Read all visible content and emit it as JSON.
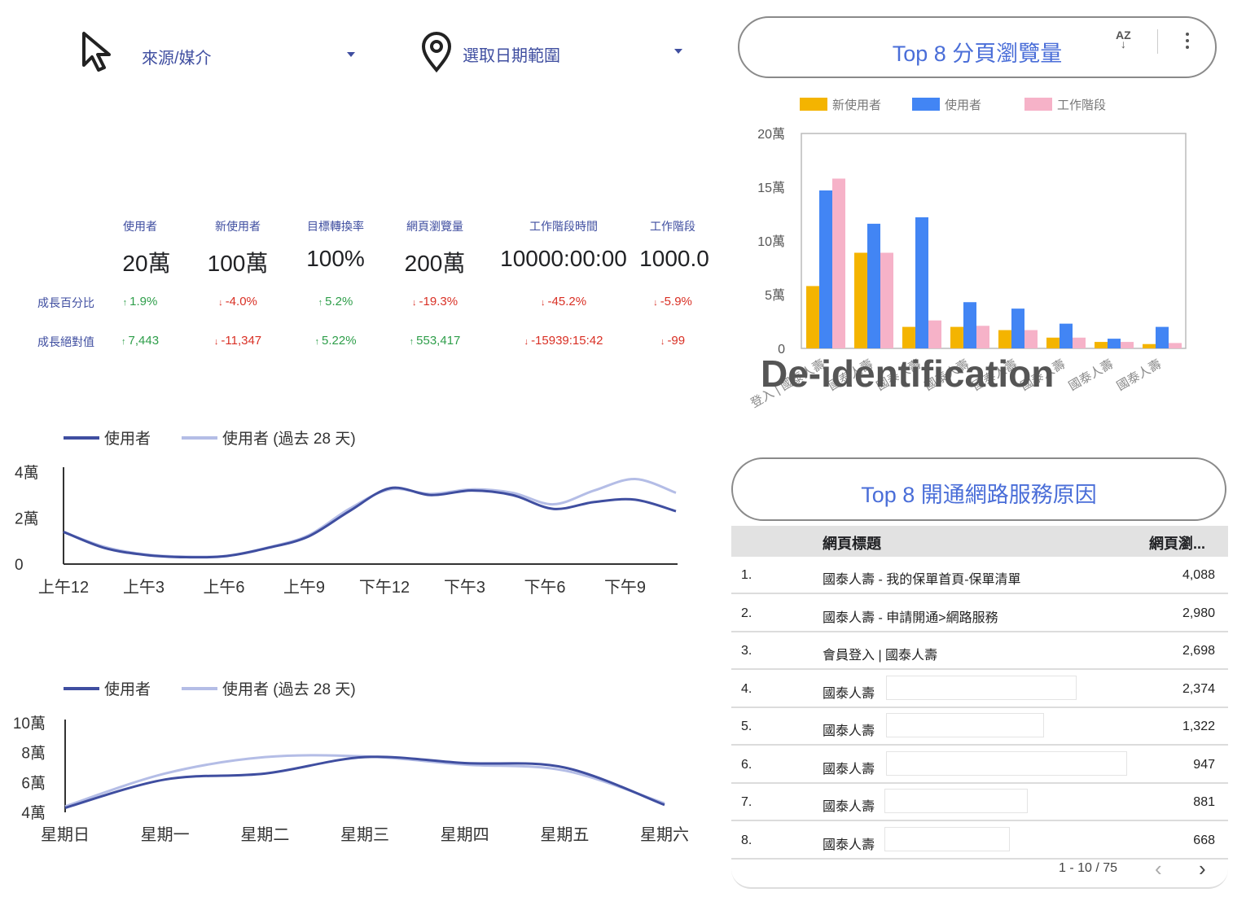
{
  "filters": {
    "source_label": "來源/媒介",
    "date_label": "選取日期範圍"
  },
  "kpis": {
    "row_pct_label": "成長百分比",
    "row_abs_label": "成長絕對值",
    "metrics": [
      {
        "name": "使用者",
        "value": "20萬",
        "pct": "1.9%",
        "pct_dir": "up",
        "abs": "7,443",
        "abs_dir": "up"
      },
      {
        "name": "新使用者",
        "value": "100萬",
        "pct": "-4.0%",
        "pct_dir": "down",
        "abs": "-11,347",
        "abs_dir": "down"
      },
      {
        "name": "目標轉換率",
        "value": "100%",
        "pct": "5.2%",
        "pct_dir": "up",
        "abs": "5.22%",
        "abs_dir": "up"
      },
      {
        "name": "網頁瀏覽量",
        "value": "200萬",
        "pct": "-19.3%",
        "pct_dir": "down",
        "abs": "553,417",
        "abs_dir": "up"
      },
      {
        "name": "工作階段時間",
        "value": "10000:00:00",
        "pct": "-45.2%",
        "pct_dir": "down",
        "abs": "-15939:15:42",
        "abs_dir": "down"
      },
      {
        "name": "工作階段",
        "value": "1000.0",
        "pct": "-5.9%",
        "pct_dir": "down",
        "abs": "-99",
        "abs_dir": "down"
      }
    ]
  },
  "chart_data": [
    {
      "type": "line",
      "x": [
        "上午12",
        "",
        "上午3",
        "",
        "上午6",
        "",
        "上午9",
        "",
        "下午12",
        "",
        "下午3",
        "",
        "下午6",
        "",
        "下午9",
        ""
      ],
      "xticks": [
        "上午12",
        "上午3",
        "上午6",
        "上午9",
        "下午12",
        "下午3",
        "下午6",
        "下午9"
      ],
      "yticks": [
        "0",
        "2萬",
        "4萬"
      ],
      "ylim": [
        0,
        40000
      ],
      "series": [
        {
          "name": "使用者",
          "color": "#3f4ea0",
          "values": [
            14000,
            7000,
            4000,
            3000,
            3500,
            7000,
            12000,
            23000,
            33000,
            30000,
            32000,
            30000,
            24000,
            27000,
            28000,
            23000
          ]
        },
        {
          "name": "使用者 (過去 28 天)",
          "color": "#b4bde6",
          "values": [
            14000,
            7500,
            4200,
            3200,
            3600,
            7200,
            12500,
            24000,
            32500,
            30500,
            32500,
            31000,
            26000,
            32000,
            37000,
            31000
          ]
        }
      ]
    },
    {
      "type": "line",
      "x": [
        "星期日",
        "星期一",
        "星期二",
        "星期三",
        "星期四",
        "星期五",
        "星期六"
      ],
      "yticks": [
        "4萬",
        "6萬",
        "8萬",
        "10萬"
      ],
      "ylim": [
        40000,
        100000
      ],
      "series": [
        {
          "name": "使用者",
          "color": "#3f4ea0",
          "values": [
            43000,
            62000,
            66000,
            77000,
            73000,
            70000,
            45000
          ]
        },
        {
          "name": "使用者 (過去 28 天)",
          "color": "#b4bde6",
          "values": [
            44000,
            66000,
            77000,
            77500,
            72000,
            68000,
            46000
          ]
        }
      ]
    },
    {
      "type": "bar",
      "title": "Top 8 分頁瀏覽量",
      "categories": [
        "登入 | 國泰人壽",
        "國泰人壽",
        "國泰人壽",
        "國泰人壽",
        "國泰人壽",
        "國泰人壽",
        "國泰人壽",
        "國泰人壽"
      ],
      "yticks": [
        "0",
        "5萬",
        "10萬",
        "15萬",
        "20萬"
      ],
      "ylim": [
        0,
        200000
      ],
      "series": [
        {
          "name": "新使用者",
          "color": "#f4b400",
          "values": [
            58000,
            89000,
            20000,
            20000,
            17000,
            10000,
            6000,
            4000
          ]
        },
        {
          "name": "使用者",
          "color": "#4285f4",
          "values": [
            147000,
            116000,
            122000,
            43000,
            37000,
            23000,
            9000,
            20000
          ]
        },
        {
          "name": "工作階段",
          "color": "#f6b2c8",
          "values": [
            158000,
            89000,
            26000,
            21000,
            17000,
            10000,
            6000,
            5000
          ]
        }
      ]
    }
  ],
  "bar_card": {
    "title": "Top 8 分頁瀏覽量",
    "sort_label": "AZ"
  },
  "deid_text": "De-identification",
  "table_card": {
    "title": "Top 8  開通網路服務原因",
    "col_title": "網頁標題",
    "col_value": "網頁瀏...",
    "rows": [
      {
        "n": "1.",
        "t": "國泰人壽 - 我的保單首頁-保單清單",
        "v": "4,088"
      },
      {
        "n": "2.",
        "t": "國泰人壽 - 申請開通>網路服務",
        "v": "2,980"
      },
      {
        "n": "3.",
        "t": "會員登入 | 國泰人壽",
        "v": "2,698"
      },
      {
        "n": "4.",
        "t": "國泰人壽",
        "v": "2,374"
      },
      {
        "n": "5.",
        "t": "國泰人壽",
        "v": "1,322"
      },
      {
        "n": "6.",
        "t": "國泰人壽",
        "v": "947"
      },
      {
        "n": "7.",
        "t": "國泰人壽",
        "v": "881"
      },
      {
        "n": "8.",
        "t": "國泰人壽",
        "v": "668"
      }
    ],
    "pager": "1 - 10 / 75"
  }
}
